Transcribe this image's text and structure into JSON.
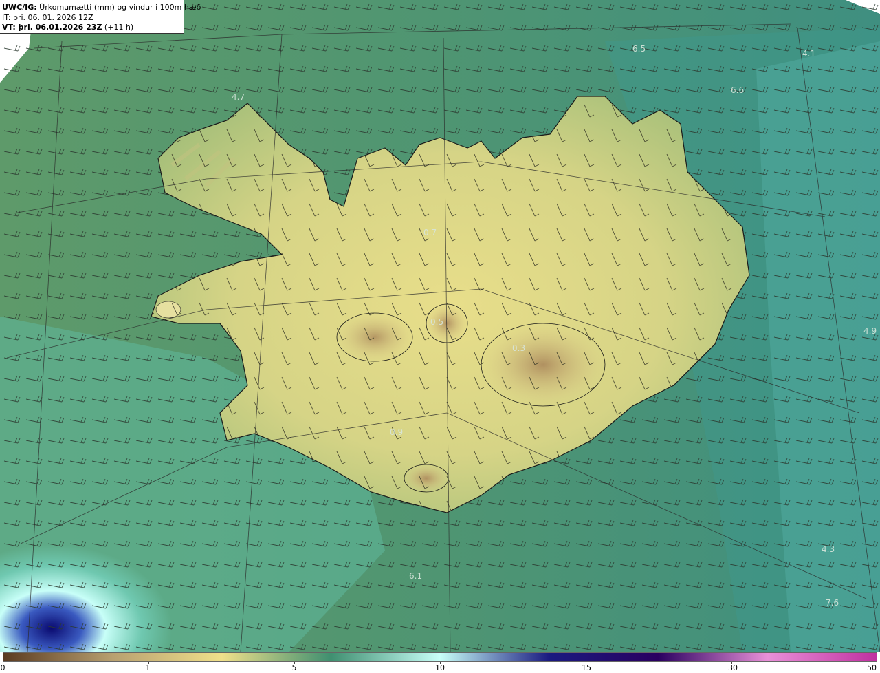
{
  "header": {
    "line1_bold": "UWC/IG:",
    "line1_text": " Úrkomumætti (mm) og vindur i 100m hæð",
    "line2": "IT: þri. 06. 01. 2026 12Z",
    "line3_bold": "VT: þri. 06.01.2026 23Z",
    "line3_text": " (+11 h)"
  },
  "colorbar": {
    "labels": [
      "0",
      "1",
      "5",
      "10",
      "15",
      "30",
      "50"
    ],
    "colors": [
      "#5a3a20",
      "#b8a070",
      "#f0e08a",
      "#3f8f70",
      "#c8fff8",
      "#1a1a80",
      "#2a0060",
      "#e890d8",
      "#c030a0"
    ]
  },
  "value_labels": [
    {
      "text": "4.7"
    },
    {
      "text": "6.5"
    },
    {
      "text": "4.1"
    },
    {
      "text": "6.6"
    },
    {
      "text": "0.7"
    },
    {
      "text": "0.5"
    },
    {
      "text": "0.3"
    },
    {
      "text": "4.9"
    },
    {
      "text": "0.9"
    },
    {
      "text": "6.1"
    },
    {
      "text": "4.3"
    },
    {
      "text": "7.6"
    }
  ]
}
